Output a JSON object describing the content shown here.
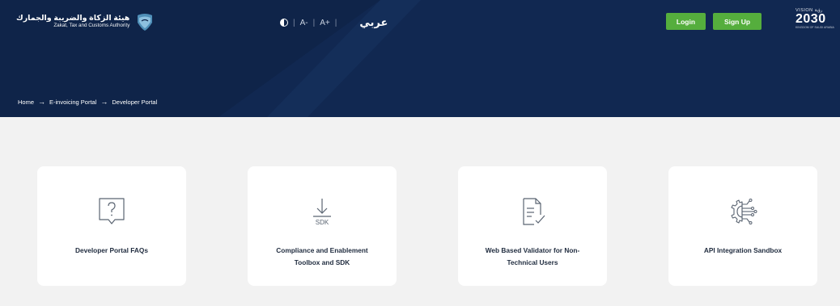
{
  "header": {
    "logo": {
      "arabic_name": "هيئة الزكاة والضريبة والجمارك",
      "english_name": "Zakat, Tax and Customs Authority",
      "icon": "zatca-emblem-icon"
    },
    "accessibility": {
      "contrast_icon": "contrast-icon",
      "decrease_font": "A-",
      "increase_font": "A+",
      "language": "عربي"
    },
    "login_label": "Login",
    "signup_label": "Sign Up",
    "vision": {
      "top": "VISION رؤية",
      "year": "2030",
      "subtitle": "KINGDOM OF SAUDI ARABIA"
    }
  },
  "breadcrumb": {
    "items": [
      "Home",
      "E-invoicing Portal",
      "Developer Portal"
    ],
    "separator": "→"
  },
  "cards": [
    {
      "title": "Developer Portal FAQs",
      "icon": "faq-speech-bubble-icon"
    },
    {
      "title": "Compliance and Enablement Toolbox and SDK",
      "icon": "sdk-download-icon",
      "icon_text": "SDK"
    },
    {
      "title": "Web Based Validator for Non-Technical Users",
      "icon": "document-check-icon"
    },
    {
      "title": "API Integration Sandbox",
      "icon": "api-gear-circuit-icon"
    }
  ],
  "colors": {
    "header_bg": "#0f2449",
    "accent_green": "#55ae3d",
    "page_bg": "#f2f2f2",
    "icon_stroke": "#5a6472"
  }
}
